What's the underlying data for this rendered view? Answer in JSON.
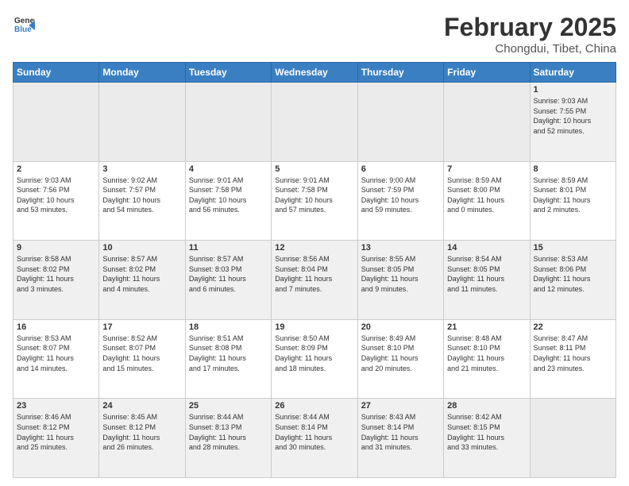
{
  "logo": {
    "line1": "General",
    "line2": "Blue"
  },
  "title": "February 2025",
  "location": "Chongdui, Tibet, China",
  "weekdays": [
    "Sunday",
    "Monday",
    "Tuesday",
    "Wednesday",
    "Thursday",
    "Friday",
    "Saturday"
  ],
  "weeks": [
    [
      {
        "day": "",
        "info": ""
      },
      {
        "day": "",
        "info": ""
      },
      {
        "day": "",
        "info": ""
      },
      {
        "day": "",
        "info": ""
      },
      {
        "day": "",
        "info": ""
      },
      {
        "day": "",
        "info": ""
      },
      {
        "day": "1",
        "info": "Sunrise: 9:03 AM\nSunset: 7:55 PM\nDaylight: 10 hours\nand 52 minutes."
      }
    ],
    [
      {
        "day": "2",
        "info": "Sunrise: 9:03 AM\nSunset: 7:56 PM\nDaylight: 10 hours\nand 53 minutes."
      },
      {
        "day": "3",
        "info": "Sunrise: 9:02 AM\nSunset: 7:57 PM\nDaylight: 10 hours\nand 54 minutes."
      },
      {
        "day": "4",
        "info": "Sunrise: 9:01 AM\nSunset: 7:58 PM\nDaylight: 10 hours\nand 56 minutes."
      },
      {
        "day": "5",
        "info": "Sunrise: 9:01 AM\nSunset: 7:58 PM\nDaylight: 10 hours\nand 57 minutes."
      },
      {
        "day": "6",
        "info": "Sunrise: 9:00 AM\nSunset: 7:59 PM\nDaylight: 10 hours\nand 59 minutes."
      },
      {
        "day": "7",
        "info": "Sunrise: 8:59 AM\nSunset: 8:00 PM\nDaylight: 11 hours\nand 0 minutes."
      },
      {
        "day": "8",
        "info": "Sunrise: 8:59 AM\nSunset: 8:01 PM\nDaylight: 11 hours\nand 2 minutes."
      }
    ],
    [
      {
        "day": "9",
        "info": "Sunrise: 8:58 AM\nSunset: 8:02 PM\nDaylight: 11 hours\nand 3 minutes."
      },
      {
        "day": "10",
        "info": "Sunrise: 8:57 AM\nSunset: 8:02 PM\nDaylight: 11 hours\nand 4 minutes."
      },
      {
        "day": "11",
        "info": "Sunrise: 8:57 AM\nSunset: 8:03 PM\nDaylight: 11 hours\nand 6 minutes."
      },
      {
        "day": "12",
        "info": "Sunrise: 8:56 AM\nSunset: 8:04 PM\nDaylight: 11 hours\nand 7 minutes."
      },
      {
        "day": "13",
        "info": "Sunrise: 8:55 AM\nSunset: 8:05 PM\nDaylight: 11 hours\nand 9 minutes."
      },
      {
        "day": "14",
        "info": "Sunrise: 8:54 AM\nSunset: 8:05 PM\nDaylight: 11 hours\nand 11 minutes."
      },
      {
        "day": "15",
        "info": "Sunrise: 8:53 AM\nSunset: 8:06 PM\nDaylight: 11 hours\nand 12 minutes."
      }
    ],
    [
      {
        "day": "16",
        "info": "Sunrise: 8:53 AM\nSunset: 8:07 PM\nDaylight: 11 hours\nand 14 minutes."
      },
      {
        "day": "17",
        "info": "Sunrise: 8:52 AM\nSunset: 8:07 PM\nDaylight: 11 hours\nand 15 minutes."
      },
      {
        "day": "18",
        "info": "Sunrise: 8:51 AM\nSunset: 8:08 PM\nDaylight: 11 hours\nand 17 minutes."
      },
      {
        "day": "19",
        "info": "Sunrise: 8:50 AM\nSunset: 8:09 PM\nDaylight: 11 hours\nand 18 minutes."
      },
      {
        "day": "20",
        "info": "Sunrise: 8:49 AM\nSunset: 8:10 PM\nDaylight: 11 hours\nand 20 minutes."
      },
      {
        "day": "21",
        "info": "Sunrise: 8:48 AM\nSunset: 8:10 PM\nDaylight: 11 hours\nand 21 minutes."
      },
      {
        "day": "22",
        "info": "Sunrise: 8:47 AM\nSunset: 8:11 PM\nDaylight: 11 hours\nand 23 minutes."
      }
    ],
    [
      {
        "day": "23",
        "info": "Sunrise: 8:46 AM\nSunset: 8:12 PM\nDaylight: 11 hours\nand 25 minutes."
      },
      {
        "day": "24",
        "info": "Sunrise: 8:45 AM\nSunset: 8:12 PM\nDaylight: 11 hours\nand 26 minutes."
      },
      {
        "day": "25",
        "info": "Sunrise: 8:44 AM\nSunset: 8:13 PM\nDaylight: 11 hours\nand 28 minutes."
      },
      {
        "day": "26",
        "info": "Sunrise: 8:44 AM\nSunset: 8:14 PM\nDaylight: 11 hours\nand 30 minutes."
      },
      {
        "day": "27",
        "info": "Sunrise: 8:43 AM\nSunset: 8:14 PM\nDaylight: 11 hours\nand 31 minutes."
      },
      {
        "day": "28",
        "info": "Sunrise: 8:42 AM\nSunset: 8:15 PM\nDaylight: 11 hours\nand 33 minutes."
      },
      {
        "day": "",
        "info": ""
      }
    ]
  ]
}
